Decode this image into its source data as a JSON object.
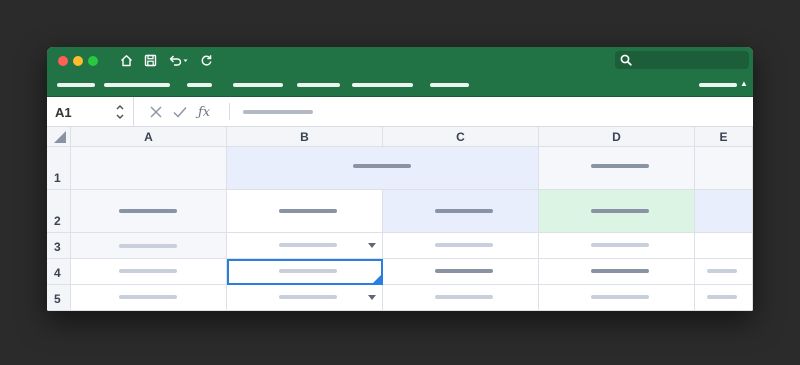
{
  "colors": {
    "titlebar": "#217346",
    "selection_border": "#2a7de1",
    "highlight_blue": "#e8eefc",
    "highlight_green": "#dcf4e3",
    "header_bg": "#f3f5f9"
  },
  "titlebar": {
    "traffic_lights": [
      "close",
      "minimize",
      "maximize"
    ],
    "icons": [
      "home-icon",
      "save-icon",
      "undo-icon",
      "redo-icon",
      "search-icon"
    ]
  },
  "ribbon": {
    "menu_items": [
      "",
      "",
      "",
      "",
      "",
      "",
      "",
      ""
    ],
    "collapse_glyph": "▲"
  },
  "formula_bar": {
    "cell_reference": "A1",
    "cancel_glyph": "✕",
    "enter_glyph": "✓",
    "function_label": "ƒx",
    "formula_value": ""
  },
  "sheet": {
    "columns": [
      "A",
      "B",
      "C",
      "D",
      "E"
    ],
    "rows": [
      "1",
      "2",
      "3",
      "4",
      "5"
    ],
    "selected_cell": "B4",
    "cells": {
      "A1": "",
      "B1": "",
      "C1": "",
      "D1": "",
      "E1": "",
      "A2": "",
      "B2": "",
      "C2": "",
      "D2": "",
      "E2": "",
      "A3": "",
      "B3": "",
      "C3": "",
      "D3": "",
      "E3": "",
      "A4": "",
      "B4": "",
      "C4": "",
      "D4": "",
      "E4": "",
      "A5": "",
      "B5": "",
      "C5": "",
      "D5": "",
      "E5": ""
    }
  }
}
